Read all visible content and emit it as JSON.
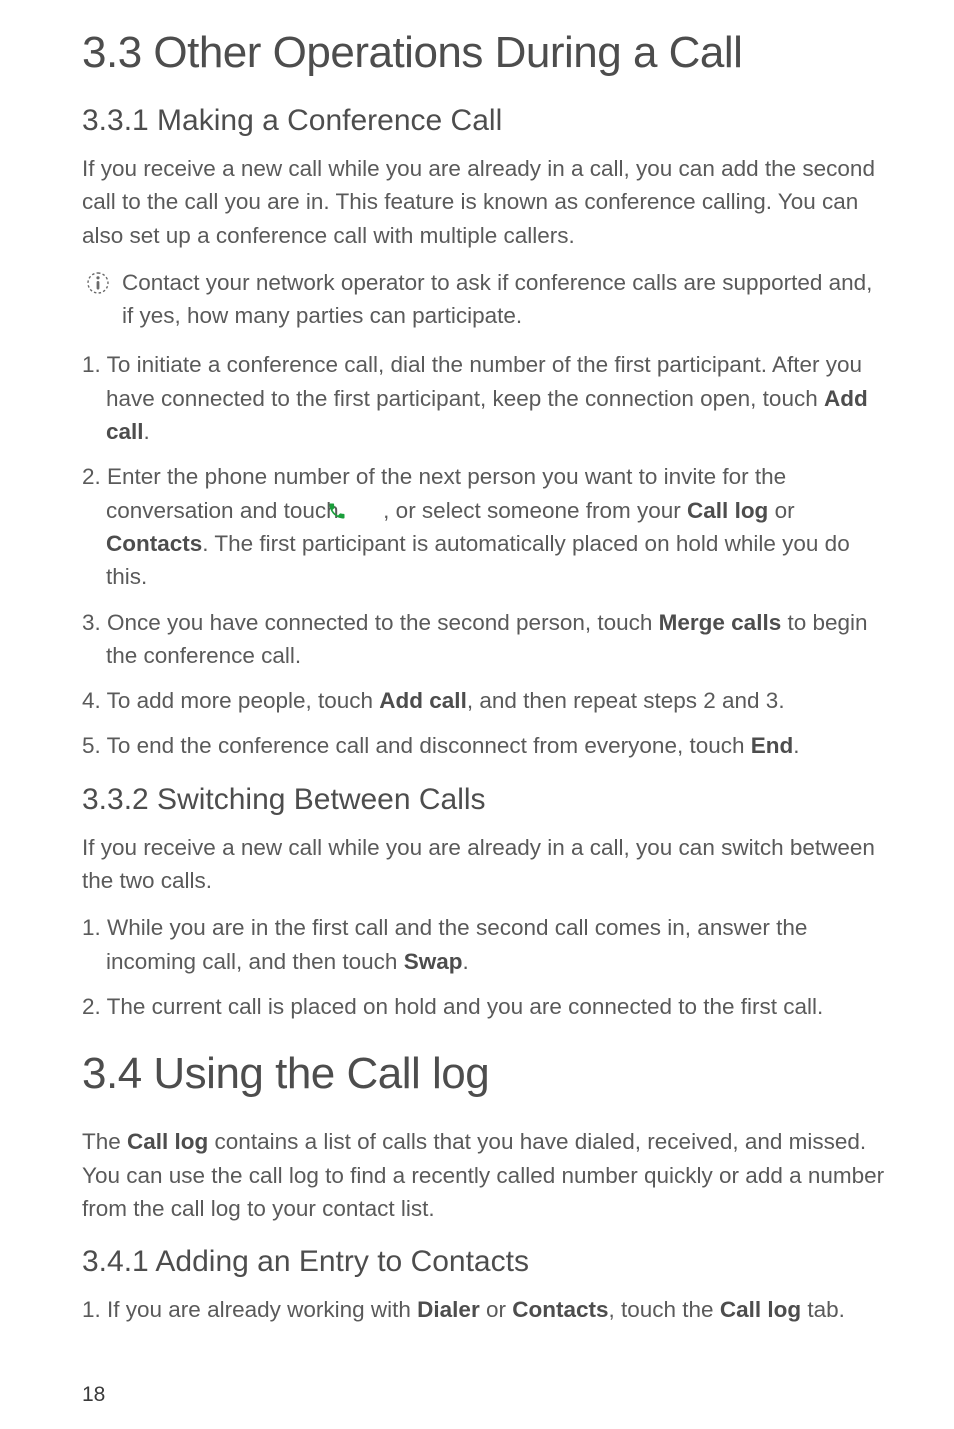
{
  "section33": {
    "heading": "3.3  Other Operations During a Call",
    "sub1": {
      "heading": "3.3.1  Making a Conference Call",
      "intro": "If you receive a new call while you are already in a call, you can add the second call to the call you are in. This feature is known as conference calling. You can also set up a conference call with multiple callers.",
      "note_icon_name": "info-icon",
      "note": "Contact your network operator to ask if conference calls are supported and, if yes, how many parties can participate.",
      "step1_prefix": "1. To initiate a conference call, dial the number of the first participant. After you have connected to the first participant, keep the connection open, touch ",
      "step1_bold": "Add call",
      "step1_suffix": ".",
      "step2_prefix": "2. Enter the phone number of the next person you want to invite for the conversation and touch ",
      "step2_icon_name": "dial-icon",
      "step2_mid1": " , or select someone from your ",
      "step2_bold1": "Call log",
      "step2_mid2": " or ",
      "step2_bold2": "Contacts",
      "step2_suffix": ". The first participant is automatically placed on hold while you do this.",
      "step3_prefix": "3. Once you have connected to the second person, touch ",
      "step3_bold": "Merge calls",
      "step3_suffix": " to begin the conference call.",
      "step4_prefix": "4. To add more people, touch ",
      "step4_bold": "Add call",
      "step4_suffix": ", and then repeat steps 2 and 3.",
      "step5_prefix": "5. To end the conference call and disconnect from everyone, touch ",
      "step5_bold": "End",
      "step5_suffix": "."
    },
    "sub2": {
      "heading": "3.3.2  Switching Between Calls",
      "intro": "If you receive a new call while you are already in a call, you can switch between the two calls.",
      "step1_prefix": "1. While you are in the first call and the second call comes in, answer the incoming call, and then touch ",
      "step1_bold": "Swap",
      "step1_suffix": ".",
      "step2": "2. The current call is placed on hold and you are connected to the first call."
    }
  },
  "section34": {
    "heading": "3.4  Using the Call log",
    "intro_prefix": "The ",
    "intro_bold1": "Call log",
    "intro_suffix": " contains a list of calls that you have dialed, received, and missed. You can use the call log to find a recently called number quickly or add a number from the call log to your contact list.",
    "sub1": {
      "heading": "3.4.1  Adding an Entry to Contacts",
      "step1_prefix": "1. If you are already working with ",
      "step1_bold1": "Dialer",
      "step1_mid1": " or ",
      "step1_bold2": "Contacts",
      "step1_mid2": ", touch the ",
      "step1_bold3": "Call log",
      "step1_suffix": " tab."
    }
  },
  "page_number": "18"
}
